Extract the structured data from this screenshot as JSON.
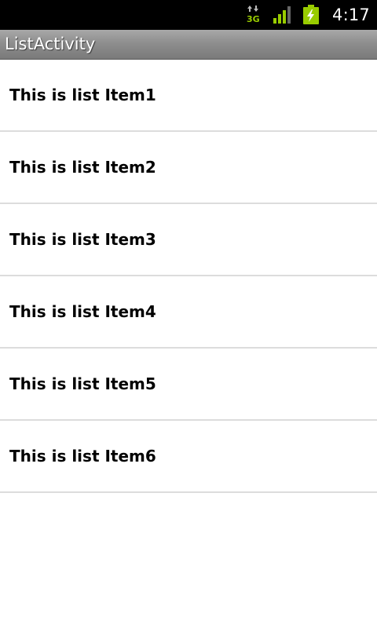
{
  "status_bar": {
    "time": "4:17",
    "network_icon": "3g-data-icon",
    "network_label": "3G",
    "signal_icon": "signal-strength-icon",
    "battery_icon": "battery-charging-icon",
    "accent_color": "#99cc00"
  },
  "title_bar": {
    "title": "ListActivity"
  },
  "list": {
    "items": [
      {
        "label": "This is list Item1"
      },
      {
        "label": "This is list Item2"
      },
      {
        "label": "This is list Item3"
      },
      {
        "label": "This is list Item4"
      },
      {
        "label": "This is list Item5"
      },
      {
        "label": "This is list Item6"
      }
    ]
  }
}
